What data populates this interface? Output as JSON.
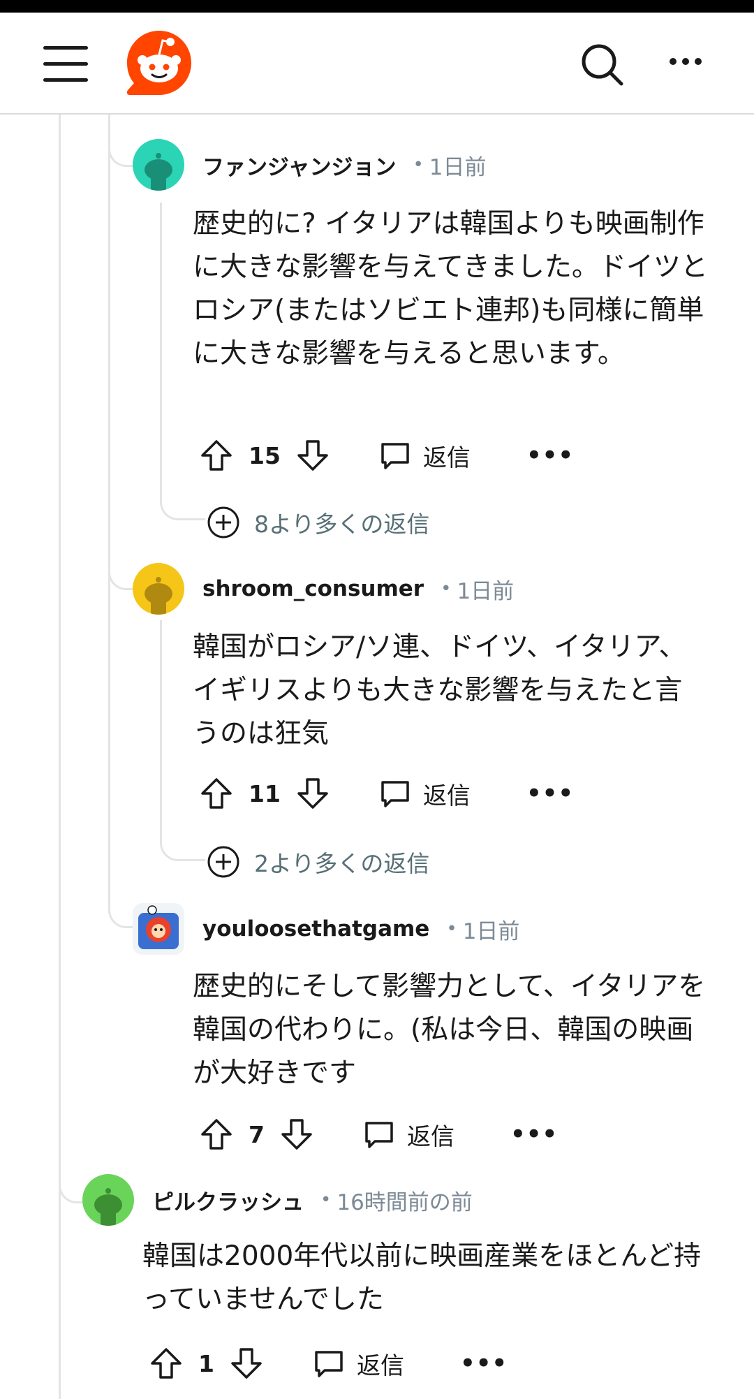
{
  "header": {
    "menu_icon": "hamburger-menu-icon",
    "logo": "reddit-logo",
    "search_icon": "search-icon",
    "more_icon": "more-horizontal-icon"
  },
  "comments": [
    {
      "username": "ファンジャンジョン",
      "time": "1日前",
      "body": "歴史的に? イタリアは韓国よりも映画制作に大きな影響を与えてきました。ドイツとロシア(またはソビエト連邦)も同様に簡単に大きな影響を与えると思います。",
      "votes": "15",
      "reply_label": "返信",
      "more_replies": "8より多くの返信",
      "avatar_color": "#2bd4b4"
    },
    {
      "username": "shroom_consumer",
      "time": "1日前",
      "body": "韓国がロシア/ソ連、ドイツ、イタリア、イギリスよりも大きな影響を与えたと言うのは狂気",
      "votes": "11",
      "reply_label": "返信",
      "more_replies": "2より多くの返信",
      "avatar_color": "#f5c518"
    },
    {
      "username": "youloosethatgame",
      "time": "1日前",
      "body": "歴史的にそして影響力として、イタリアを韓国の代わりに。(私は今日、韓国の映画が大好きです",
      "votes": "7",
      "reply_label": "返信",
      "avatar_color": "#e8412c"
    },
    {
      "username": "ピルクラッシュ",
      "time": "16時間前の前",
      "body": "韓国は2000年代以前に映画産業をほとんど持っていませんでした",
      "votes": "1",
      "reply_label": "返信",
      "avatar_color": "#6ad45a"
    }
  ],
  "colors": {
    "accent": "#ff4500",
    "meta": "#7c8a96",
    "thread": "#e2e4e6"
  }
}
